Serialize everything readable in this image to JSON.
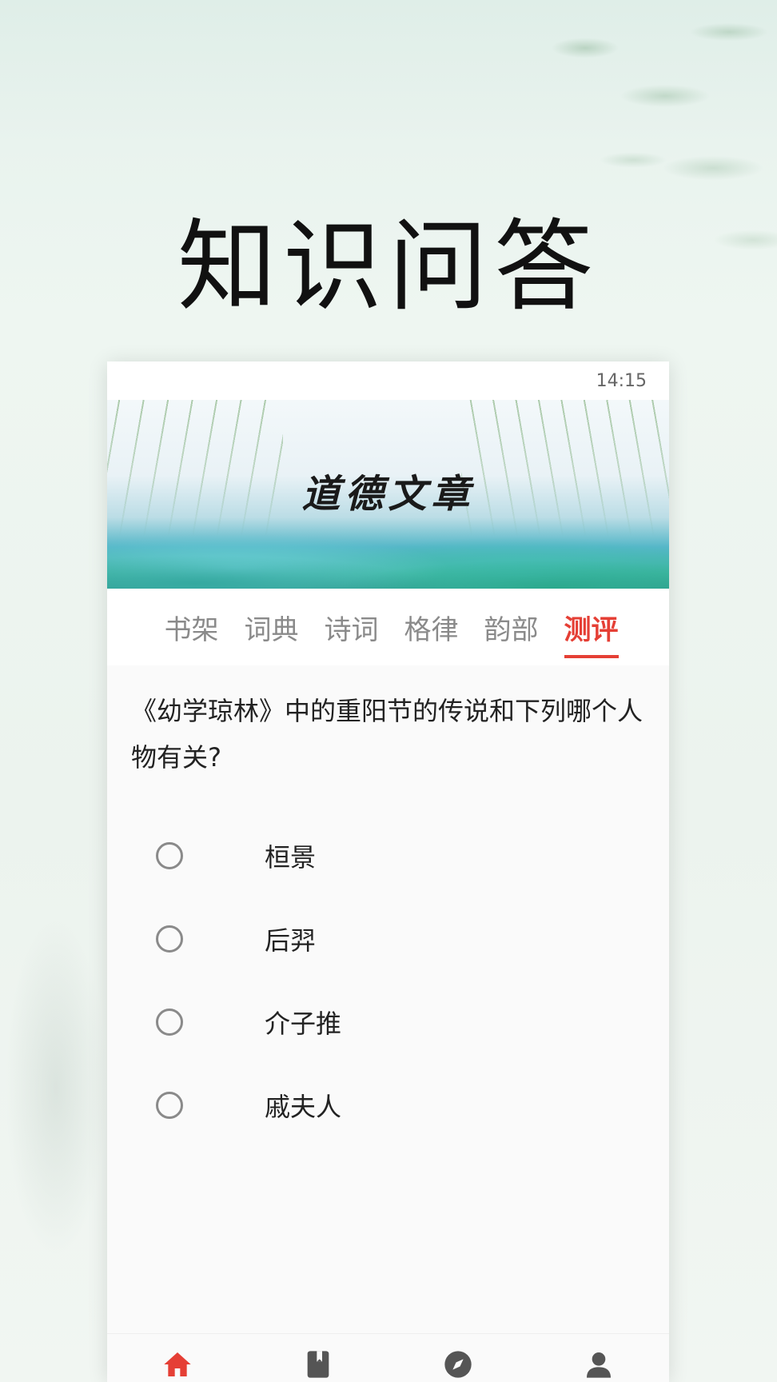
{
  "hero": {
    "title": "知识问答"
  },
  "phone": {
    "status_time": "14:15",
    "banner_title": "道德文章",
    "tabs": [
      {
        "label": "书架",
        "active": false
      },
      {
        "label": "词典",
        "active": false
      },
      {
        "label": "诗词",
        "active": false
      },
      {
        "label": "格律",
        "active": false
      },
      {
        "label": "韵部",
        "active": false
      },
      {
        "label": "测评",
        "active": true
      }
    ],
    "question": "《幼学琼林》中的重阳节的传说和下列哪个人物有关?",
    "options": [
      {
        "label": "桓景"
      },
      {
        "label": "后羿"
      },
      {
        "label": "介子推"
      },
      {
        "label": "戚夫人"
      }
    ],
    "bottom_nav": [
      {
        "icon": "home-icon",
        "active": true
      },
      {
        "icon": "book-icon",
        "active": false
      },
      {
        "icon": "compass-icon",
        "active": false
      },
      {
        "icon": "user-icon",
        "active": false
      }
    ]
  },
  "colors": {
    "accent": "#e53f35",
    "tab_inactive": "#8a8a8a",
    "nav_icon": "#555555"
  }
}
